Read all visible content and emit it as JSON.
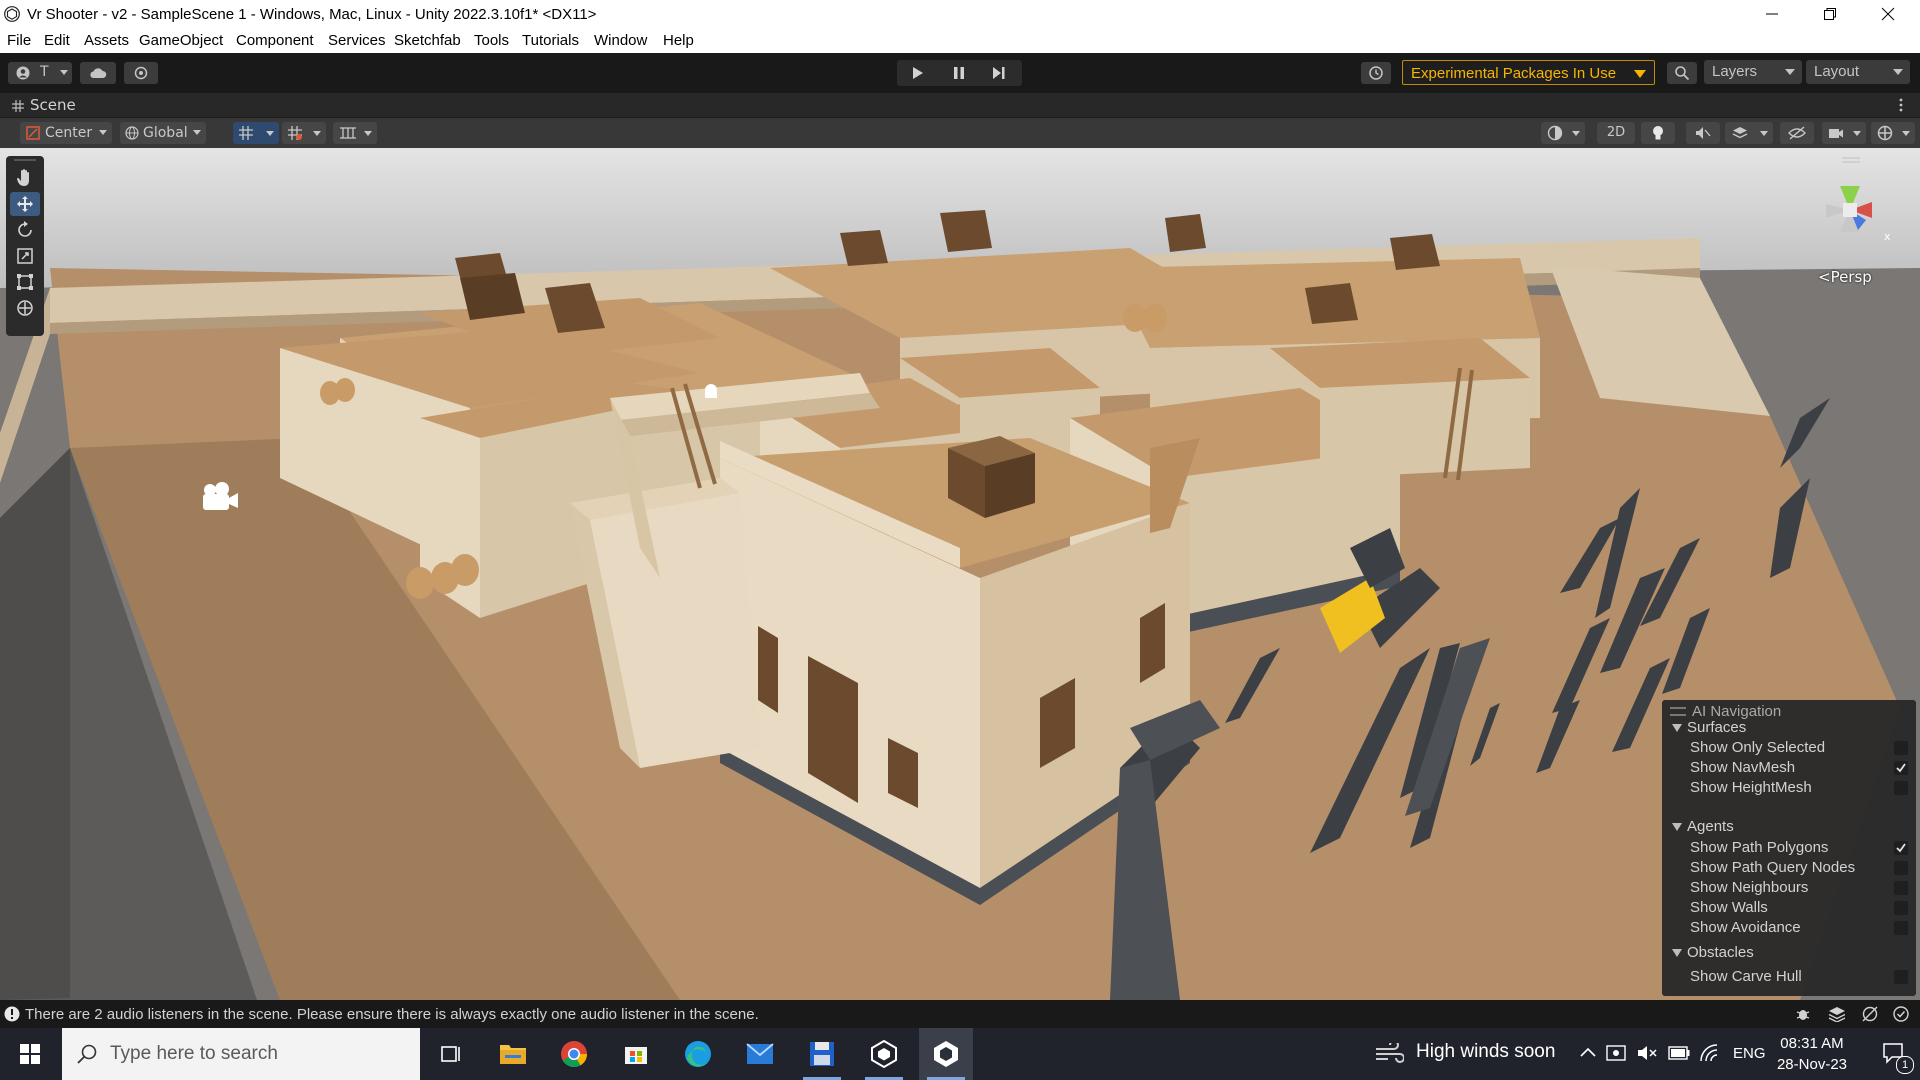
{
  "window": {
    "title": "Vr Shooter - v2 - SampleScene 1 - Windows, Mac, Linux - Unity 2022.3.10f1* <DX11>"
  },
  "menu": [
    "File",
    "Edit",
    "Assets",
    "GameObject",
    "Component",
    "Services",
    "Sketchfab",
    "Tools",
    "Tutorials",
    "Window",
    "Help"
  ],
  "toolbar": {
    "account_label": "T",
    "experimental_label": "Experimental Packages In Use",
    "layers_label": "Layers",
    "layout_label": "Layout"
  },
  "scene_tab": {
    "label": "Scene"
  },
  "scene_toolbar": {
    "pivot_label": "Center",
    "space_label": "Global",
    "mode_2d_label": "2D"
  },
  "gizmo": {
    "projection_label": "<Persp",
    "axis_x": "x"
  },
  "ai_navigation": {
    "title": "AI Navigation",
    "sections": [
      {
        "label": "Surfaces",
        "items": [
          {
            "label": "Show Only Selected",
            "checked": false
          },
          {
            "label": "Show NavMesh",
            "checked": true
          },
          {
            "label": "Show HeightMesh",
            "checked": false
          }
        ]
      },
      {
        "label": "Agents",
        "items": [
          {
            "label": "Show Path Polygons",
            "checked": true
          },
          {
            "label": "Show Path Query Nodes",
            "checked": false
          },
          {
            "label": "Show Neighbours",
            "checked": false
          },
          {
            "label": "Show Walls",
            "checked": false
          },
          {
            "label": "Show Avoidance",
            "checked": false
          }
        ]
      },
      {
        "label": "Obstacles",
        "items": [
          {
            "label": "Show Carve Hull",
            "checked": false
          }
        ]
      }
    ]
  },
  "status": {
    "message": "There are 2 audio listeners in the scene. Please ensure there is always exactly one audio listener in the scene."
  },
  "taskbar": {
    "search_placeholder": "Type here to search",
    "weather": "High winds soon",
    "language": "ENG",
    "time": "08:31 AM",
    "date": "28-Nov-23",
    "notification_count": "1",
    "apps": [
      "task-view",
      "file-explorer",
      "chrome",
      "microsoft-store",
      "edge",
      "mail",
      "save-app",
      "unity-hub",
      "unity-editor"
    ]
  },
  "colors": {
    "editor_bg": "#191919",
    "sky": "#c8c8c8",
    "ground": "#b48e68",
    "wall": "#e2d2b8",
    "roof": "#c49a6c",
    "crate": "#6b4a2e",
    "accent_warning": "#f7b500"
  }
}
